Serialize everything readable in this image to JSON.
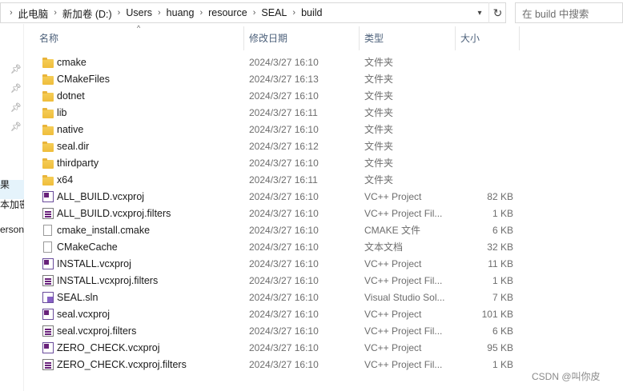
{
  "address_bar": {
    "crumbs": [
      "此电脑",
      "新加卷 (D:)",
      "Users",
      "huang",
      "resource",
      "SEAL",
      "build"
    ]
  },
  "search": {
    "placeholder": "在 build 中搜索"
  },
  "nav": {
    "partial_labels": [
      "果",
      "本加密",
      "ersona"
    ]
  },
  "columns": {
    "name": "名称",
    "date": "修改日期",
    "type": "类型",
    "size": "大小"
  },
  "files": [
    {
      "name": "cmake",
      "date": "2024/3/27 16:10",
      "type": "文件夹",
      "size": "",
      "icon": "folder-icon"
    },
    {
      "name": "CMakeFiles",
      "date": "2024/3/27 16:13",
      "type": "文件夹",
      "size": "",
      "icon": "folder-icon"
    },
    {
      "name": "dotnet",
      "date": "2024/3/27 16:10",
      "type": "文件夹",
      "size": "",
      "icon": "folder-icon"
    },
    {
      "name": "lib",
      "date": "2024/3/27 16:11",
      "type": "文件夹",
      "size": "",
      "icon": "folder-icon"
    },
    {
      "name": "native",
      "date": "2024/3/27 16:10",
      "type": "文件夹",
      "size": "",
      "icon": "folder-icon"
    },
    {
      "name": "seal.dir",
      "date": "2024/3/27 16:12",
      "type": "文件夹",
      "size": "",
      "icon": "folder-icon"
    },
    {
      "name": "thirdparty",
      "date": "2024/3/27 16:10",
      "type": "文件夹",
      "size": "",
      "icon": "folder-icon"
    },
    {
      "name": "x64",
      "date": "2024/3/27 16:11",
      "type": "文件夹",
      "size": "",
      "icon": "folder-icon"
    },
    {
      "name": "ALL_BUILD.vcxproj",
      "date": "2024/3/27 16:10",
      "type": "VC++ Project",
      "size": "82 KB",
      "icon": "vcxproj-icon"
    },
    {
      "name": "ALL_BUILD.vcxproj.filters",
      "date": "2024/3/27 16:10",
      "type": "VC++ Project Fil...",
      "size": "1 KB",
      "icon": "filters-icon"
    },
    {
      "name": "cmake_install.cmake",
      "date": "2024/3/27 16:10",
      "type": "CMAKE 文件",
      "size": "6 KB",
      "icon": "document-icon"
    },
    {
      "name": "CMakeCache",
      "date": "2024/3/27 16:10",
      "type": "文本文档",
      "size": "32 KB",
      "icon": "document-icon"
    },
    {
      "name": "INSTALL.vcxproj",
      "date": "2024/3/27 16:10",
      "type": "VC++ Project",
      "size": "11 KB",
      "icon": "vcxproj-icon"
    },
    {
      "name": "INSTALL.vcxproj.filters",
      "date": "2024/3/27 16:10",
      "type": "VC++ Project Fil...",
      "size": "1 KB",
      "icon": "filters-icon"
    },
    {
      "name": "SEAL.sln",
      "date": "2024/3/27 16:10",
      "type": "Visual Studio Sol...",
      "size": "7 KB",
      "icon": "sln-icon"
    },
    {
      "name": "seal.vcxproj",
      "date": "2024/3/27 16:10",
      "type": "VC++ Project",
      "size": "101 KB",
      "icon": "vcxproj-icon"
    },
    {
      "name": "seal.vcxproj.filters",
      "date": "2024/3/27 16:10",
      "type": "VC++ Project Fil...",
      "size": "6 KB",
      "icon": "filters-icon"
    },
    {
      "name": "ZERO_CHECK.vcxproj",
      "date": "2024/3/27 16:10",
      "type": "VC++ Project",
      "size": "95 KB",
      "icon": "vcxproj-icon"
    },
    {
      "name": "ZERO_CHECK.vcxproj.filters",
      "date": "2024/3/27 16:10",
      "type": "VC++ Project Fil...",
      "size": "1 KB",
      "icon": "filters-icon"
    }
  ],
  "watermark": "CSDN @叫你皮",
  "colors": {
    "header_text": "#4c607a",
    "folder": "#f5cd57",
    "selection": "#e5f3fb"
  }
}
